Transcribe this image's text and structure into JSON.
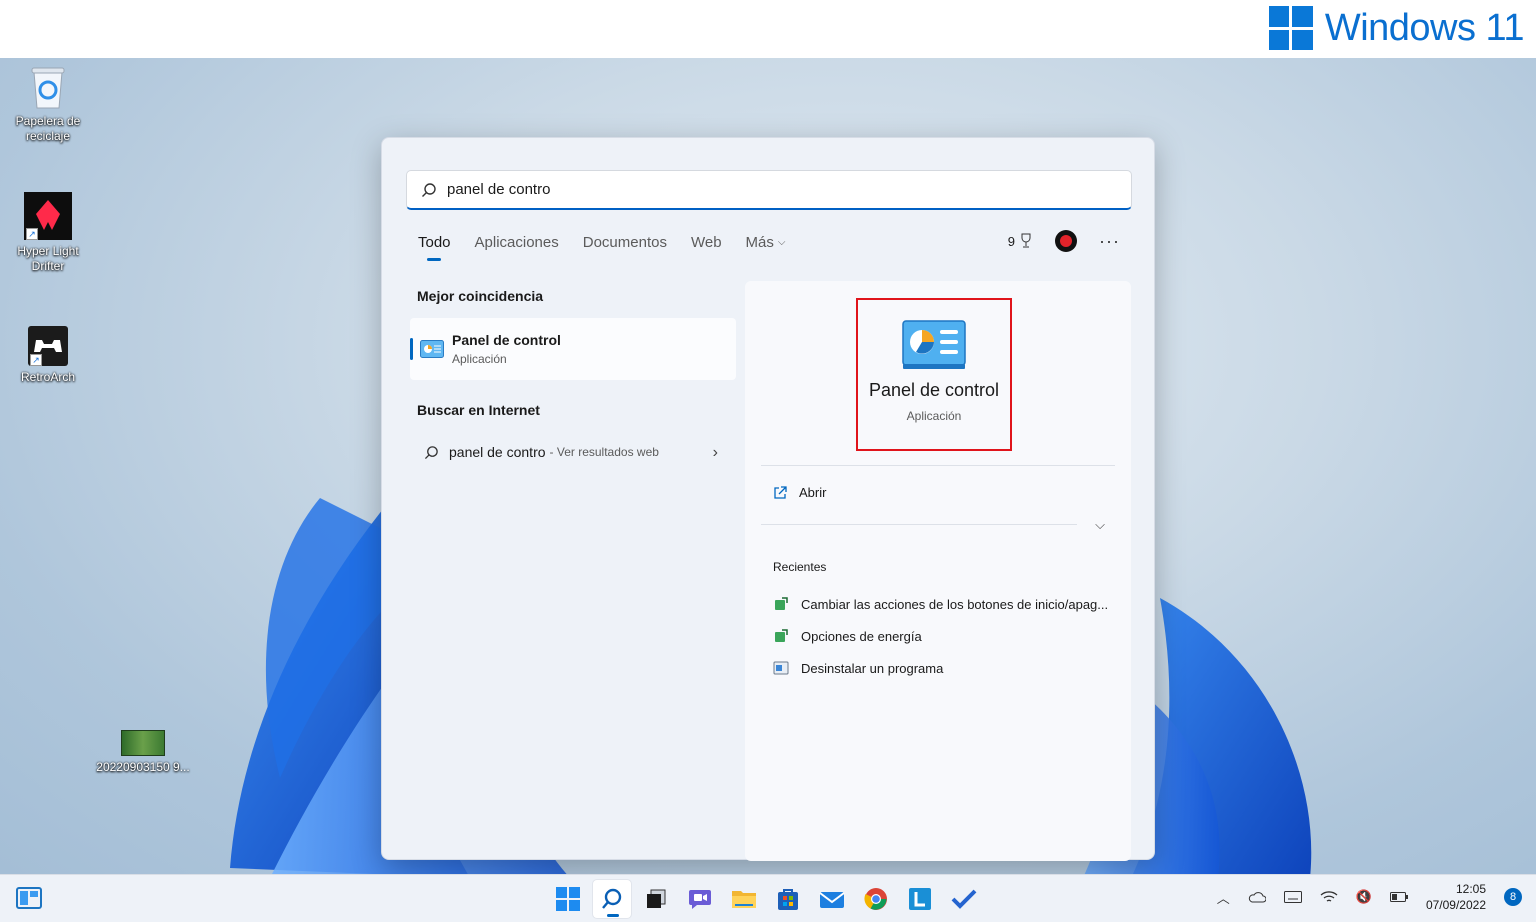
{
  "banner": {
    "brand": "Windows 11"
  },
  "desktop": {
    "icons": [
      {
        "label": "Papelera de reciclaje"
      },
      {
        "label": "Hyper Light Drifter"
      },
      {
        "label": "RetroArch"
      },
      {
        "label": "20220903150 9..."
      }
    ]
  },
  "search": {
    "query": "panel de contro",
    "tabs": [
      "Todo",
      "Aplicaciones",
      "Documentos",
      "Web",
      "Más"
    ],
    "points": "9",
    "best_match_title": "Mejor coincidencia",
    "best_match": {
      "name": "Panel de control",
      "type": "Aplicación"
    },
    "web_title": "Buscar en Internet",
    "web_query": "panel de contro",
    "web_hint": "- Ver resultados web",
    "detail": {
      "name": "Panel de control",
      "type": "Aplicación",
      "action": "Abrir",
      "recent_title": "Recientes",
      "recent": [
        "Cambiar las acciones de los botones de inicio/apag...",
        "Opciones de energía",
        "Desinstalar un programa"
      ]
    }
  },
  "taskbar": {
    "apps": [
      "start-icon",
      "search-icon",
      "task-view-icon",
      "chat-icon",
      "file-explorer-icon",
      "store-icon",
      "mail-icon",
      "chrome-icon",
      "app-l-icon",
      "todo-icon"
    ],
    "time": "12:05",
    "date": "07/09/2022",
    "notifications": "8"
  },
  "colors": {
    "accent": "#0067c0",
    "highlight": "#e0141b",
    "brand": "#0a78d7"
  }
}
